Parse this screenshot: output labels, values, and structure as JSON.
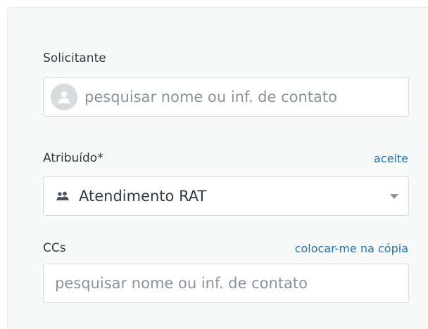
{
  "requester": {
    "label": "Solicitante",
    "placeholder": "pesquisar nome ou inf. de contato",
    "avatar_icon": "user-avatar-icon"
  },
  "assignee": {
    "label": "Atribuído*",
    "take_it_link": "aceite",
    "selected_value": "Atendimento RAT",
    "group_icon": "group-icon",
    "dropdown_icon": "chevron-down-icon"
  },
  "ccs": {
    "label": "CCs",
    "cc_me_link": "colocar-me na cópia",
    "placeholder": "pesquisar nome ou inf. de contato"
  },
  "colors": {
    "panel_bg": "#f8f9f9",
    "text": "#2f3941",
    "placeholder": "#87929d",
    "link": "#1f73b7",
    "border": "#d8dcde"
  }
}
